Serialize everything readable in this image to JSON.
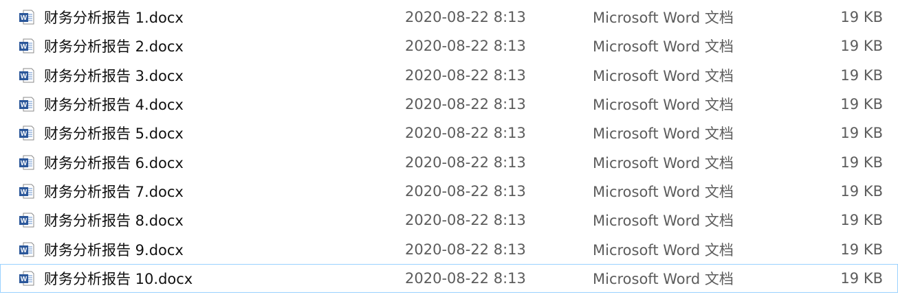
{
  "files": [
    {
      "name": "财务分析报告 1.docx",
      "date": "2020-08-22 8:13",
      "type": "Microsoft Word 文档",
      "size": "19 KB"
    },
    {
      "name": "财务分析报告 2.docx",
      "date": "2020-08-22 8:13",
      "type": "Microsoft Word 文档",
      "size": "19 KB"
    },
    {
      "name": "财务分析报告 3.docx",
      "date": "2020-08-22 8:13",
      "type": "Microsoft Word 文档",
      "size": "19 KB"
    },
    {
      "name": "财务分析报告 4.docx",
      "date": "2020-08-22 8:13",
      "type": "Microsoft Word 文档",
      "size": "19 KB"
    },
    {
      "name": "财务分析报告 5.docx",
      "date": "2020-08-22 8:13",
      "type": "Microsoft Word 文档",
      "size": "19 KB"
    },
    {
      "name": "财务分析报告 6.docx",
      "date": "2020-08-22 8:13",
      "type": "Microsoft Word 文档",
      "size": "19 KB"
    },
    {
      "name": "财务分析报告 7.docx",
      "date": "2020-08-22 8:13",
      "type": "Microsoft Word 文档",
      "size": "19 KB"
    },
    {
      "name": "财务分析报告 8.docx",
      "date": "2020-08-22 8:13",
      "type": "Microsoft Word 文档",
      "size": "19 KB"
    },
    {
      "name": "财务分析报告 9.docx",
      "date": "2020-08-22 8:13",
      "type": "Microsoft Word 文档",
      "size": "19 KB"
    },
    {
      "name": "财务分析报告 10.docx",
      "date": "2020-08-22 8:13",
      "type": "Microsoft Word 文档",
      "size": "19 KB",
      "focused": true
    }
  ],
  "icon": {
    "name": "word-document-icon",
    "accent_color": "#2b579a",
    "glyph": "W"
  }
}
